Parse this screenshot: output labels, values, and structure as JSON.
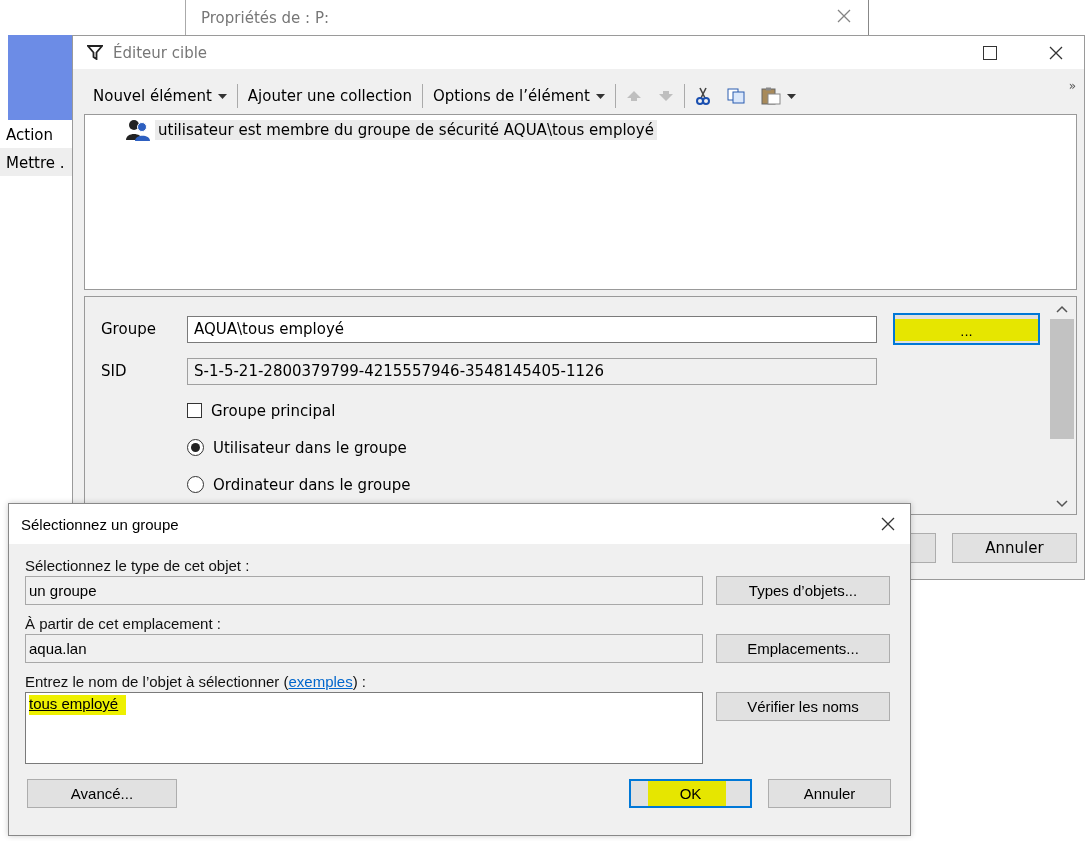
{
  "background_window": {
    "title": "Propriétés de : P:"
  },
  "side_panel": {
    "items": [
      {
        "label": "Action",
        "selected": false
      },
      {
        "label": "Mettre .",
        "selected": true
      }
    ]
  },
  "editor": {
    "title": "Éditeur cible",
    "toolbar": [
      {
        "kind": "menu",
        "label": "Nouvel élément"
      },
      {
        "kind": "button",
        "label": "Ajouter une collection"
      },
      {
        "kind": "menu",
        "label": "Options de l’élément"
      },
      {
        "kind": "move-up",
        "disabled": true
      },
      {
        "kind": "move-down",
        "disabled": true
      },
      {
        "kind": "cut",
        "disabled": false
      },
      {
        "kind": "copy",
        "disabled": false
      },
      {
        "kind": "paste",
        "disabled": false
      }
    ],
    "overflow": "»",
    "items": [
      {
        "text": "utilisateur est membre du groupe de sécurité AQUA\\tous employé",
        "selected": true
      }
    ],
    "group_label": "Groupe",
    "group_value": "AQUA\\tous employé",
    "browse_button": {
      "label": "...",
      "highlighted": true
    },
    "sid_label": "SID",
    "sid_value": "S-1-5-21-2800379799-4215557946-3548145405-1126",
    "options": [
      {
        "kind": "checkbox",
        "label": "Groupe principal",
        "checked": false
      },
      {
        "kind": "radio",
        "label": "Utilisateur dans le groupe",
        "selected": true
      },
      {
        "kind": "radio",
        "label": "Ordinateur dans le groupe",
        "selected": false
      }
    ],
    "cancel_button": "Annuler"
  },
  "dialog": {
    "title": "Sélectionnez un groupe",
    "sections": [
      {
        "label": "Sélectionnez le type de cet objet :",
        "value": "un groupe",
        "button": "Types d’objets..."
      },
      {
        "label": "À partir de cet emplacement :",
        "value": "aqua.lan",
        "button": "Emplacements..."
      }
    ],
    "name_label_before": "Entrez le nom de l’objet à sélectionner (",
    "name_link": "exemples",
    "name_label_after": ") :",
    "name_value": "tous employé",
    "name_highlighted": true,
    "name_resolved": true,
    "check_button": "Vérifier les noms",
    "advanced_button": "Avancé...",
    "ok_button": {
      "label": "OK",
      "highlighted": true
    },
    "cancel_button": "Annuler"
  }
}
